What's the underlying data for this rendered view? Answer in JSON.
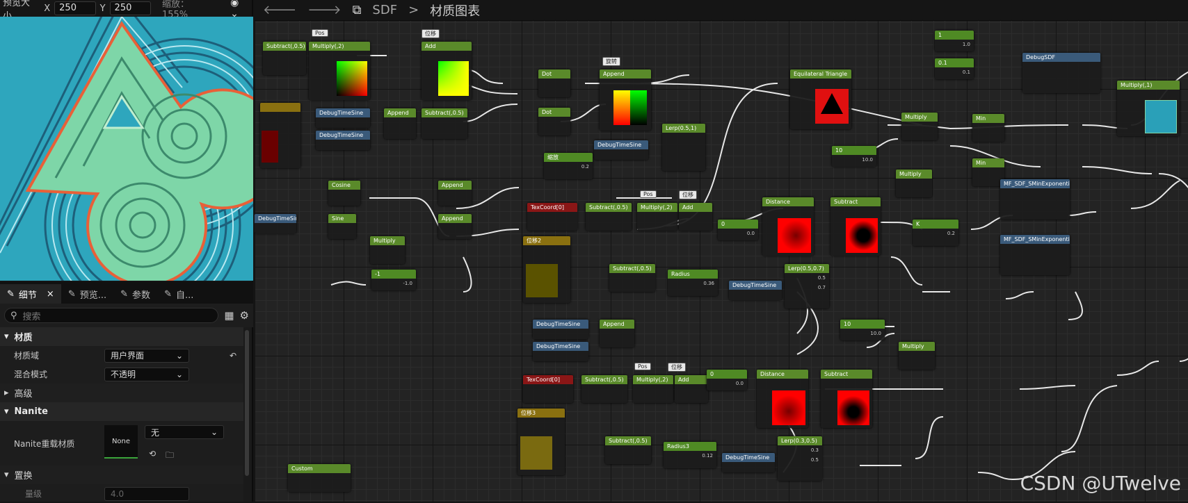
{
  "preview": {
    "size_label": "预览大小",
    "x_label": "X",
    "x_value": "250",
    "y_label": "Y",
    "y_value": "250",
    "zoom_text": "缩放：155%"
  },
  "tabs": [
    {
      "label": "细节"
    },
    {
      "label": "预览..."
    },
    {
      "label": "参数"
    },
    {
      "label": "自..."
    }
  ],
  "search": {
    "placeholder": "搜索"
  },
  "details": {
    "cat_material": "材质",
    "material_domain_label": "材质域",
    "material_domain_value": "用户界面",
    "blend_mode_label": "混合模式",
    "blend_mode_value": "不透明",
    "cat_advanced": "高级",
    "cat_nanite": "Nanite",
    "nanite_override_label": "Nanite重载材质",
    "nanite_thumb_label": "None",
    "nanite_dropdown_value": "无",
    "cat_displacement": "置换",
    "magnitude_label": "量级",
    "magnitude_value": "4.0"
  },
  "graph": {
    "breadcrumb_root": "SDF",
    "breadcrumb_sep": ">",
    "breadcrumb_current": "材质图表",
    "nodes": {
      "subtract_top": "Subtract(,0.5)",
      "multiply2_top": "Multiply(,2)",
      "pos_tag": "Pos",
      "offset_tag": "位移",
      "rotate_tag": "旋转",
      "add_top": "Add",
      "dot1": "Dot",
      "dot2": "Dot",
      "append_top": "Append",
      "equilateral": "Equilateral Triangle",
      "one": "1",
      "val_1": "1.0",
      "zero_one": "0.1",
      "val_01": "0.1",
      "debugsdf": "DebugSDF",
      "multiply1": "Multiply(,1)",
      "debugtimesine_a": "DebugTimeSine",
      "debugtimesine_b": "DebugTimeSine",
      "append_mid": "Append",
      "subtract_mid": "Subtract(,0.5)",
      "lerp_top": "Lerp(0.5,1)",
      "debugtimesine_c": "DebugTimeSine",
      "scale_param": "缩放",
      "scale_default": "0.2",
      "multiply_r1": "Multiply",
      "min1": "Min",
      "ten_top": "10",
      "ten_val": "10.0",
      "min2": "Min",
      "multiply_r2": "Multiply",
      "cosine": "Cosine",
      "sine": "Sine",
      "append_c": "Append",
      "append_s": "Append",
      "multiply_s": "Multiply",
      "neg_one": "-1",
      "neg_one_val": "-1.0",
      "debugtimesine_left": "DebugTimeSine",
      "texcoord1": "TexCoord[0]",
      "subtract_t1": "Subtract(,0.5)",
      "multiply_t1": "Multiply(,2)",
      "add_t1": "Add",
      "distance1": "Distance",
      "subtract_d1": "Subtract",
      "zero1": "0",
      "zero1_val": "0.0",
      "k_param": "K",
      "k_val": "0.2",
      "mf_sdf1": "MF_SDF_SMinExponential",
      "mf_sdf2": "MF_SDF_SMinExponential",
      "offset2": "位移2",
      "subtract_r": "Subtract(,0.5)",
      "radius": "Radius",
      "radius_val": "0.36",
      "debugtimesine_r": "DebugTimeSine",
      "lerp_r": "Lerp(0.5,0.7)",
      "lerp_r_a": "0.5",
      "lerp_r_b": "0.7",
      "debugtimesine_o1": "DebugTimeSine",
      "debugtimesine_o2": "DebugTimeSine",
      "append_o": "Append",
      "ten_bottom": "10",
      "ten_bottom_val": "10.0",
      "multiply_bottom": "Multiply",
      "texcoord2": "TexCoord[0]",
      "subtract_t2": "Subtract(,0.5)",
      "multiply_t2": "Multiply(,2)",
      "add_t2": "Add",
      "zero2": "0",
      "zero2_val": "0.0",
      "distance2": "Distance",
      "subtract_d2": "Subtract",
      "offset3": "位移3",
      "subtract_b": "Subtract(,0.5)",
      "radius3": "Radius3",
      "radius3_val": "0.12",
      "debugtimesine_b3": "DebugTimeSine",
      "lerp_b": "Lerp(0.3,0.5)",
      "lerp_b_a": "0.3",
      "lerp_b_b": "0.5",
      "custom": "Custom"
    }
  },
  "watermark": "CSDN @UTwelve"
}
